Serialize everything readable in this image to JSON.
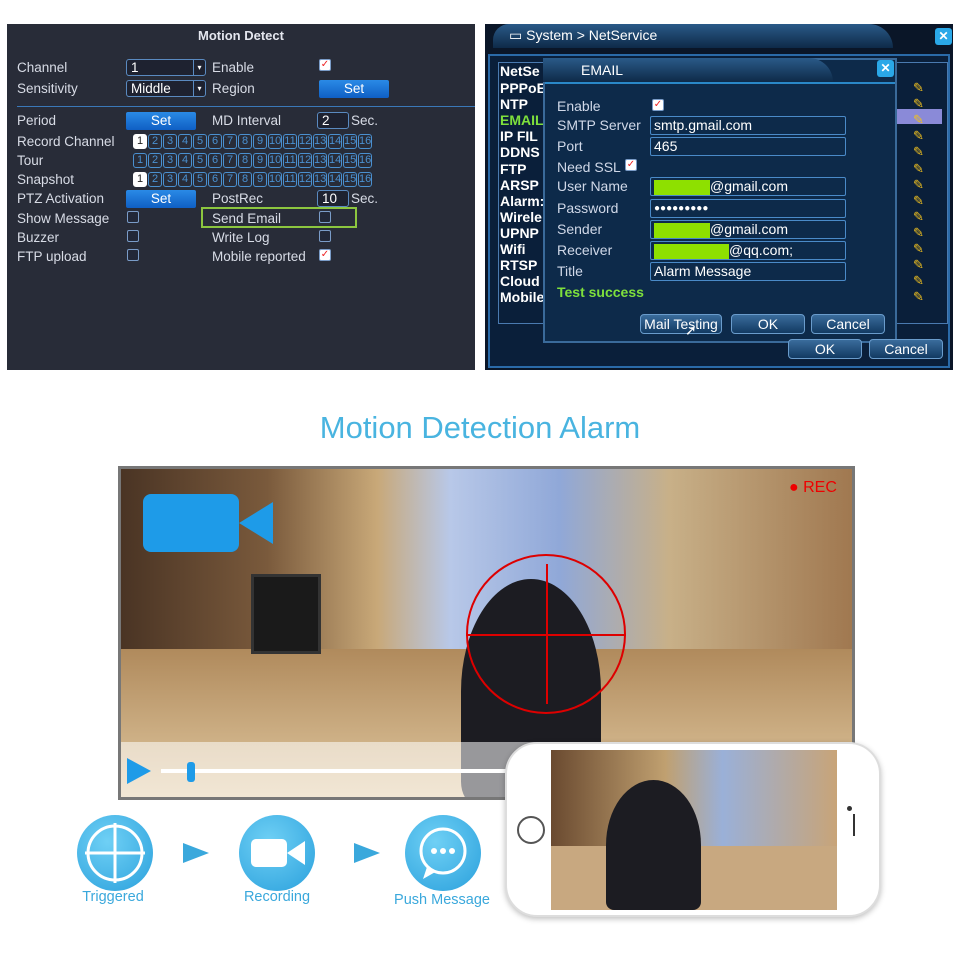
{
  "motion_detect": {
    "title": "Motion Detect",
    "channel": {
      "label": "Channel",
      "value": "1"
    },
    "enable": {
      "label": "Enable",
      "checked": true
    },
    "sensitivity": {
      "label": "Sensitivity",
      "value": "Middle"
    },
    "region": {
      "label": "Region",
      "button": "Set"
    },
    "period": {
      "label": "Period",
      "button": "Set"
    },
    "md_interval": {
      "label": "MD Interval",
      "value": "2",
      "unit": "Sec."
    },
    "record_channel": {
      "label": "Record Channel",
      "selected": [
        1
      ]
    },
    "tour": {
      "label": "Tour",
      "selected": []
    },
    "snapshot": {
      "label": "Snapshot",
      "selected": [
        1
      ]
    },
    "channels": [
      "1",
      "2",
      "3",
      "4",
      "5",
      "6",
      "7",
      "8",
      "9",
      "10",
      "11",
      "12",
      "13",
      "14",
      "15",
      "16"
    ],
    "ptz": {
      "label": "PTZ Activation",
      "button": "Set"
    },
    "postrec": {
      "label": "PostRec",
      "value": "10",
      "unit": "Sec."
    },
    "show_message": {
      "label": "Show Message",
      "checked": false
    },
    "send_email": {
      "label": "Send Email",
      "checked": false,
      "highlight": "#8cc63f"
    },
    "buzzer": {
      "label": "Buzzer",
      "checked": false
    },
    "write_log": {
      "label": "Write Log",
      "checked": false
    },
    "ftp_upload": {
      "label": "FTP upload",
      "checked": false
    },
    "mobile_reported": {
      "label": "Mobile reported",
      "checked": true
    }
  },
  "netservice": {
    "breadcrumb": "System > NetService",
    "list_header": "NetSe",
    "items": [
      "PPPoE",
      "NTP",
      "EMAIL",
      "IP FIL",
      "DDNS",
      "FTP",
      "ARSP",
      "Alarm:",
      "Wirele",
      "UPNP",
      "Wifi",
      "RTSP",
      "Cloud",
      "Mobile"
    ],
    "selected": "EMAIL",
    "ok": "OK",
    "cancel": "Cancel",
    "email": {
      "title": "EMAIL",
      "enable_label": "Enable",
      "enable": true,
      "smtp_label": "SMTP Server",
      "smtp": "smtp.gmail.com",
      "port_label": "Port",
      "port": "465",
      "ssl_label": "Need SSL",
      "ssl": true,
      "user_label": "User Name",
      "user_suffix": "@gmail.com",
      "password_label": "Password",
      "password": "●●●●●●●●●",
      "sender_label": "Sender",
      "sender_suffix": "@gmail.com",
      "receiver_label": "Receiver",
      "receiver_suffix": "@qq.com;",
      "title_label": "Title",
      "title_value": "Alarm Message",
      "status": "Test success",
      "mail_testing": "Mail Testing",
      "ok": "OK",
      "cancel": "Cancel"
    }
  },
  "headline": "Motion Detection Alarm",
  "video": {
    "rec": "REC"
  },
  "flow": [
    {
      "label": "Triggered",
      "icon": "crosshair-icon"
    },
    {
      "label": "Recording",
      "icon": "video-camera-icon"
    },
    {
      "label": "Push Message",
      "icon": "chat-bubble-icon"
    }
  ],
  "colors": {
    "accent": "#49b4e0",
    "rec": "#e00000",
    "success": "#7ee03c"
  }
}
